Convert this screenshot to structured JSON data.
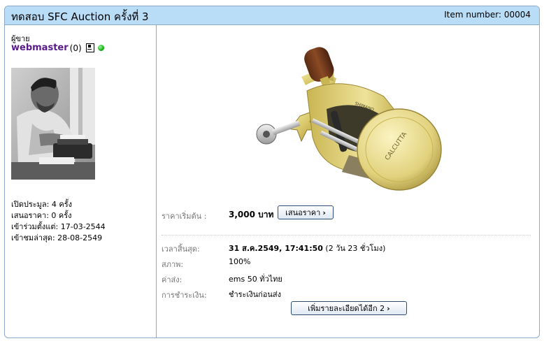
{
  "header": {
    "title": "ทดสอบ SFC Auction ครั้งที่ 3",
    "item_number": "Item number: 00004"
  },
  "seller": {
    "label": "ผู้ขาย",
    "name": "webmaster",
    "score": "(0)",
    "status_color": "#14b214"
  },
  "stats": {
    "opened": "เปิดประมูล: 4 ครั้ง",
    "bids": "เสนอราคา: 0 ครั้ง",
    "joined": "เข้าร่วมตั้งแต่: 17-03-2544",
    "last_visit": "เข้าชมล่าสุด: 28-08-2549"
  },
  "pricing": {
    "start_label": "ราคาเริ่มต้น :",
    "start_value": "3,000 บาท",
    "bid_button": "เสนอราคา",
    "end_label": "เวลาสิ้นสุด:",
    "end_value": "31 ส.ค.2549, 17:41:50",
    "end_remaining": "(2 วัน 23 ชั่วโมง)",
    "condition_label": "สภาพ:",
    "condition_value": "100%",
    "shipping_label": "ค่าส่ง:",
    "shipping_value": "ems 50 ทั่วไทย",
    "payment_label": "การชำระเงิน:",
    "payment_value": "ชำระเงินก่อนส่ง",
    "more_button": "เพิ่มรายละเอียดได้อีก 2"
  },
  "product": {
    "brand_text_1": "SHIMANO",
    "brand_text_2": "CALCUTTA"
  },
  "colors": {
    "header_bg": "#b9dcf7",
    "border": "#8da9c8",
    "seller_name": "#5a1a8c"
  }
}
